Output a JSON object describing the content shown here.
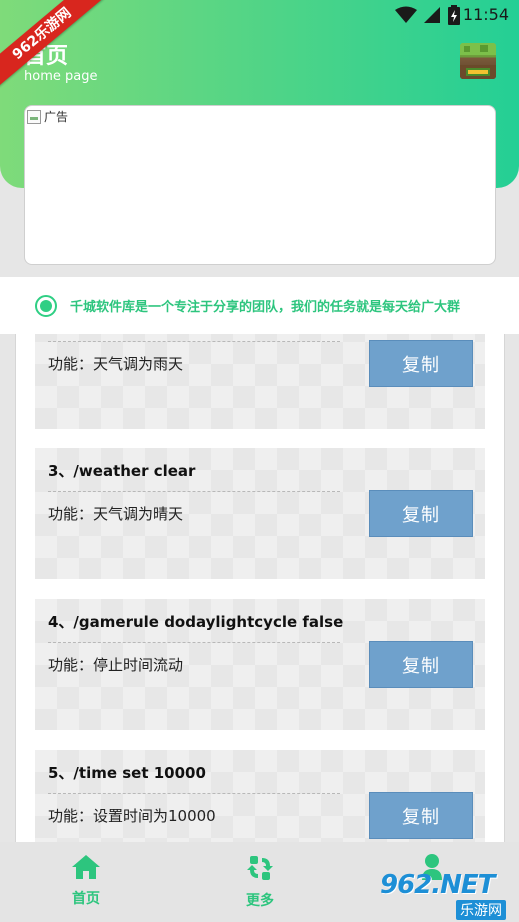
{
  "status_bar": {
    "time": "11:54"
  },
  "ribbon": {
    "text": "962乐游网"
  },
  "header": {
    "title": "首页",
    "subtitle": "home page"
  },
  "ad": {
    "alt_text": "广告"
  },
  "notice": {
    "text": "千城软件库是一个专注于分享的团队，我们的任务就是每天给广大群"
  },
  "commands": [
    {
      "cmd": "",
      "func": "功能：天气调为雨天",
      "copy_label": "复制"
    },
    {
      "cmd": "3、/weather clear",
      "func": "功能：天气调为晴天",
      "copy_label": "复制"
    },
    {
      "cmd": "4、/gamerule dodaylightcycle false",
      "func": "功能：停止时间流动",
      "copy_label": "复制"
    },
    {
      "cmd": "5、/time set 10000",
      "func": "功能：设置时间为10000",
      "copy_label": "复制"
    }
  ],
  "bottom_nav": {
    "items": [
      {
        "label": "首页",
        "icon": "home-icon"
      },
      {
        "label": "更多",
        "icon": "refresh-icon"
      },
      {
        "label": "",
        "icon": "user-icon"
      }
    ]
  },
  "watermark": {
    "main": "962.NET",
    "sub": "乐游网"
  },
  "colors": {
    "accent": "#2dc57e",
    "copy_button": "#6fa1cc",
    "ribbon": "#d8261e"
  }
}
